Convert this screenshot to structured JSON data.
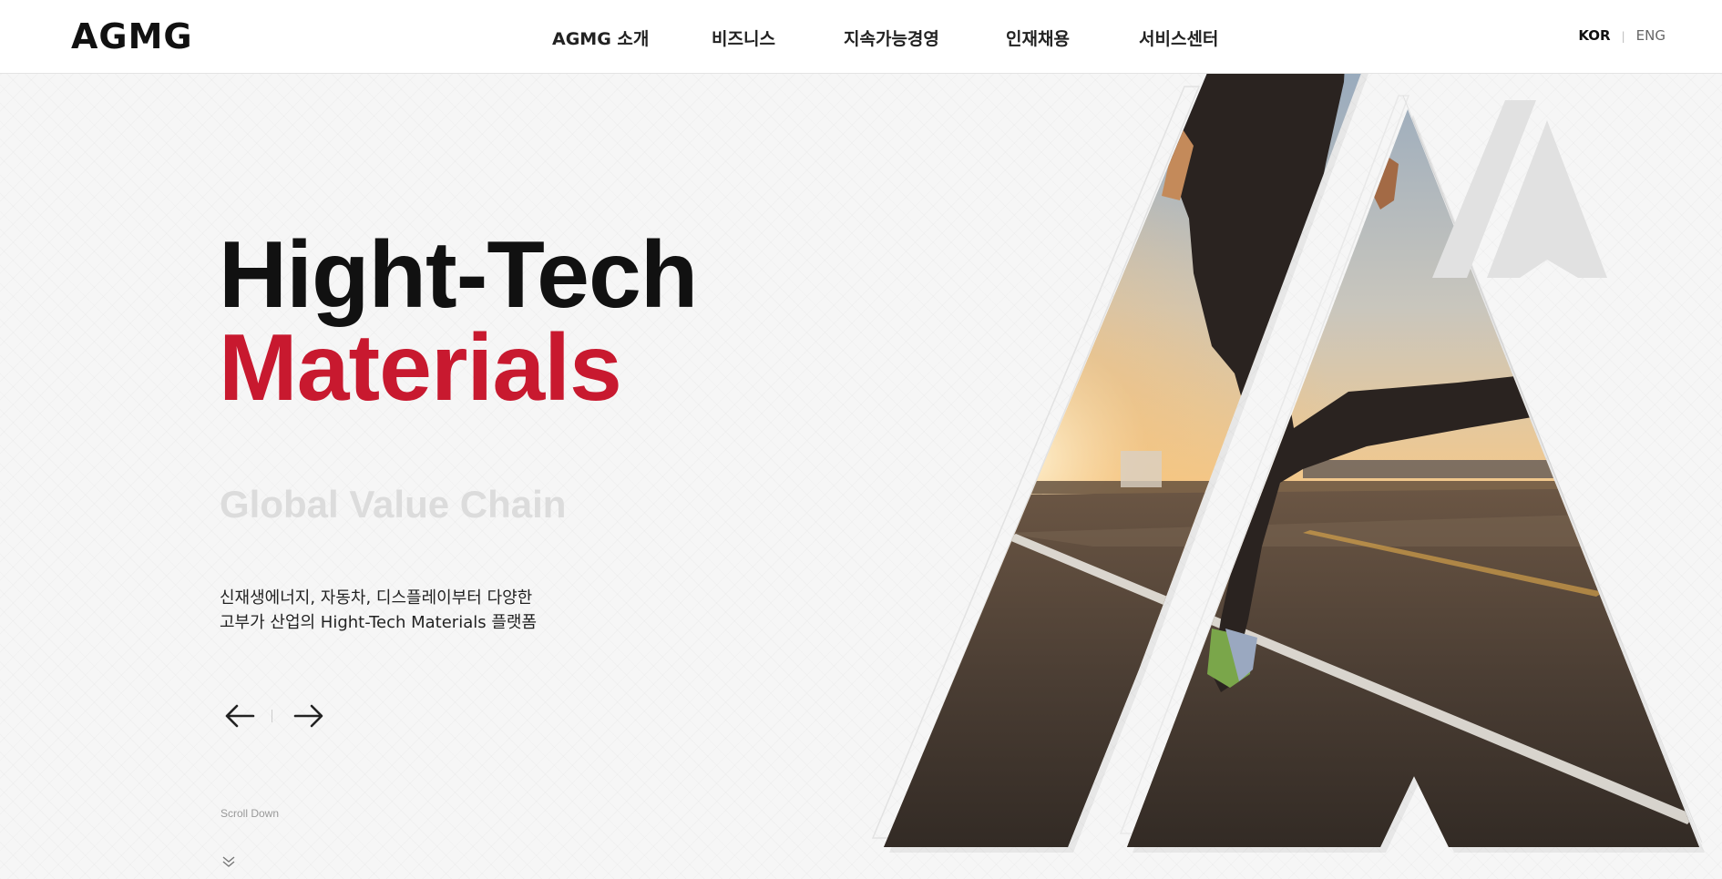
{
  "header": {
    "logo": "AGMG",
    "nav": [
      "AGMG 소개",
      "비즈니스",
      "지속가능경영",
      "인재채용",
      "서비스센터"
    ],
    "lang": {
      "kor": "KOR",
      "eng": "ENG",
      "active": "KOR"
    }
  },
  "hero": {
    "title_line1": "Hight-Tech",
    "title_line2": "Materials",
    "subtitle": "Global Value Chain",
    "desc_line1": "신재생에너지, 자동차, 디스플레이부터 다양한",
    "desc_line2": "고부가 산업의 Hight-Tech Materials 플랫폼",
    "scroll_label": "Scroll Down"
  },
  "colors": {
    "accent": "#c8192f",
    "text_dark": "#111111",
    "subtitle_gray": "#dcdcdc",
    "background": "#f6f6f6"
  },
  "icons": {
    "prev": "arrow-left-icon",
    "next": "arrow-right-icon",
    "scroll": "double-chevron-down-icon"
  }
}
